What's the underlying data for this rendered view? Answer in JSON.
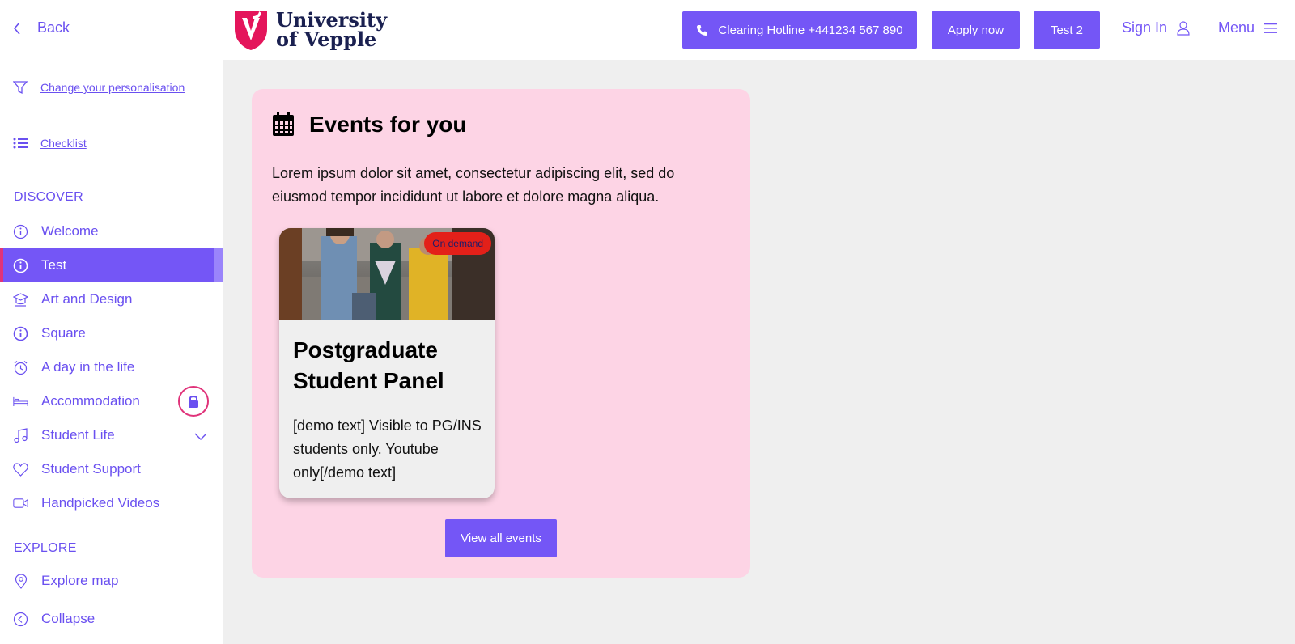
{
  "sidebar": {
    "back_label": "Back",
    "personalisation_label": "Change your personalisation",
    "checklist_label": "Checklist",
    "discover_label": "DISCOVER",
    "items": [
      {
        "label": "Welcome",
        "icon": "info-circle-icon"
      },
      {
        "label": "Test",
        "icon": "info-circle-icon"
      },
      {
        "label": "Art and Design",
        "icon": "graduation-icon"
      },
      {
        "label": "Square",
        "icon": "info-circle-icon"
      },
      {
        "label": "A day in the life",
        "icon": "alarm-clock-icon"
      },
      {
        "label": "Accommodation",
        "icon": "bed-icon"
      },
      {
        "label": "Student Life",
        "icon": "music-note-icon"
      },
      {
        "label": "Student Support",
        "icon": "heart-icon"
      },
      {
        "label": "Handpicked Videos",
        "icon": "video-camera-icon"
      }
    ],
    "explore_label": "EXPLORE",
    "explore_map_label": "Explore map",
    "collapse_label": "Collapse"
  },
  "header": {
    "logo_line1": "University",
    "logo_line2": "of Vepple",
    "hotline_label": "Clearing Hotline +441234 567 890",
    "apply_label": "Apply now",
    "test2_label": "Test 2",
    "signin_label": "Sign In",
    "menu_label": "Menu"
  },
  "panel": {
    "title": "Events for you",
    "description": "Lorem ipsum dolor sit amet, consectetur adipiscing elit, sed do eiusmod tempor incididunt ut labore et dolore magna aliqua.",
    "card": {
      "badge": "On demand",
      "title": "Postgraduate Student Panel",
      "text": "[demo text] Visible to PG/INS students only. Youtube only[/demo text]"
    },
    "view_all_label": "View all events"
  },
  "colors": {
    "accent": "#7456f6",
    "highlight": "#e0337a",
    "panel_bg": "#fdd4e5",
    "badge_bg": "#e32019"
  }
}
